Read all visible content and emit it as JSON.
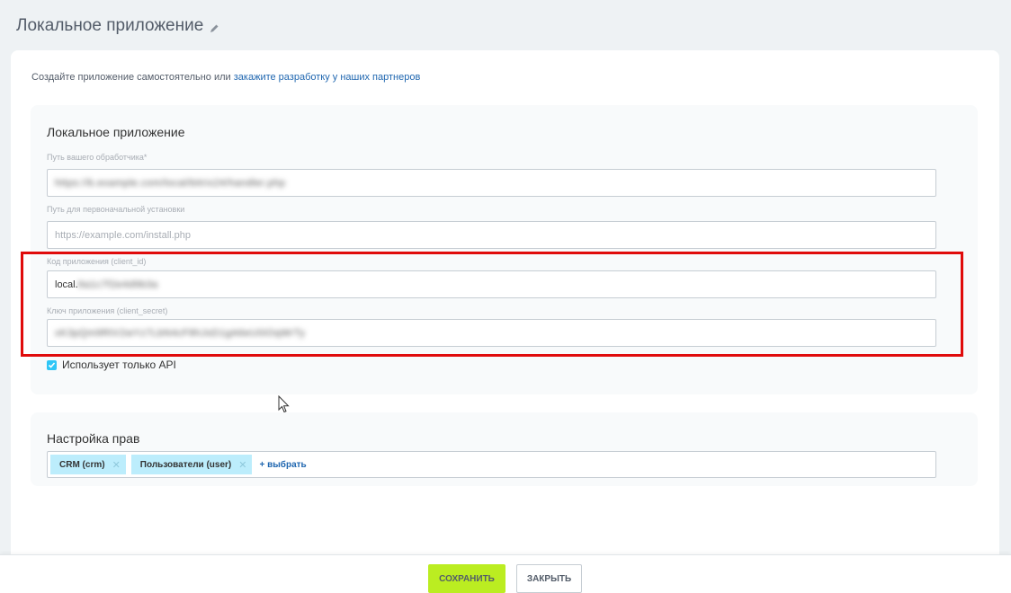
{
  "page": {
    "title": "Локальное приложение"
  },
  "intro": {
    "text": "Создайте приложение самостоятельно или ",
    "link": "закажите разработку у наших партнеров"
  },
  "local_section": {
    "title": "Локальное приложение",
    "handler_path": {
      "label": "Путь вашего обработчика*",
      "value": "https://b.example.com/local/bitrix24/handler.php"
    },
    "install_path": {
      "label": "Путь для первоначальной установки",
      "placeholder": "https://example.com/install.php"
    },
    "client_id": {
      "label": "Код приложения (client_id)",
      "value_visible": "local.",
      "value_hidden": "6a1c7f2e4d9b3a"
    },
    "client_secret": {
      "label": "Ключ приложения (client_secret)",
      "value_hidden": "xK3pQm9RtV2wYz7LbN4cF8hJsD1gA6eU0iOqWrTy"
    },
    "api_only": {
      "label": "Использует только API",
      "checked": true
    }
  },
  "rights_section": {
    "title": "Настройка прав",
    "tags": [
      {
        "label": "CRM (crm)"
      },
      {
        "label": "Пользователи (user)"
      }
    ],
    "add_label": "выбрать"
  },
  "footer": {
    "save_label": "СОХРАНИТЬ",
    "close_label": "ЗАКРЫТЬ"
  },
  "colors": {
    "accent_save": "#bbed21",
    "highlight": "#e00b0b",
    "tag_bg": "#bcedfc",
    "link": "#2067b0"
  }
}
